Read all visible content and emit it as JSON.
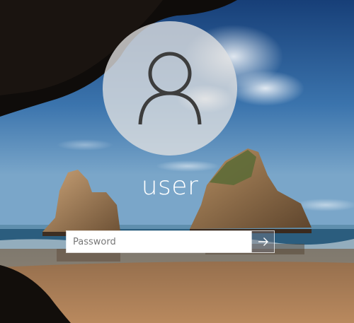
{
  "lock_screen": {
    "username": "user",
    "password_field": {
      "placeholder": "Password",
      "value": ""
    },
    "submit_icon": "arrow-right-icon",
    "avatar_icon": "user-silhouette-icon",
    "colors": {
      "sky_top": "#2a5f9e",
      "sea": "#1f4f6e",
      "sand": "#a87a55",
      "avatar_bg": "#e1e1e1"
    }
  }
}
